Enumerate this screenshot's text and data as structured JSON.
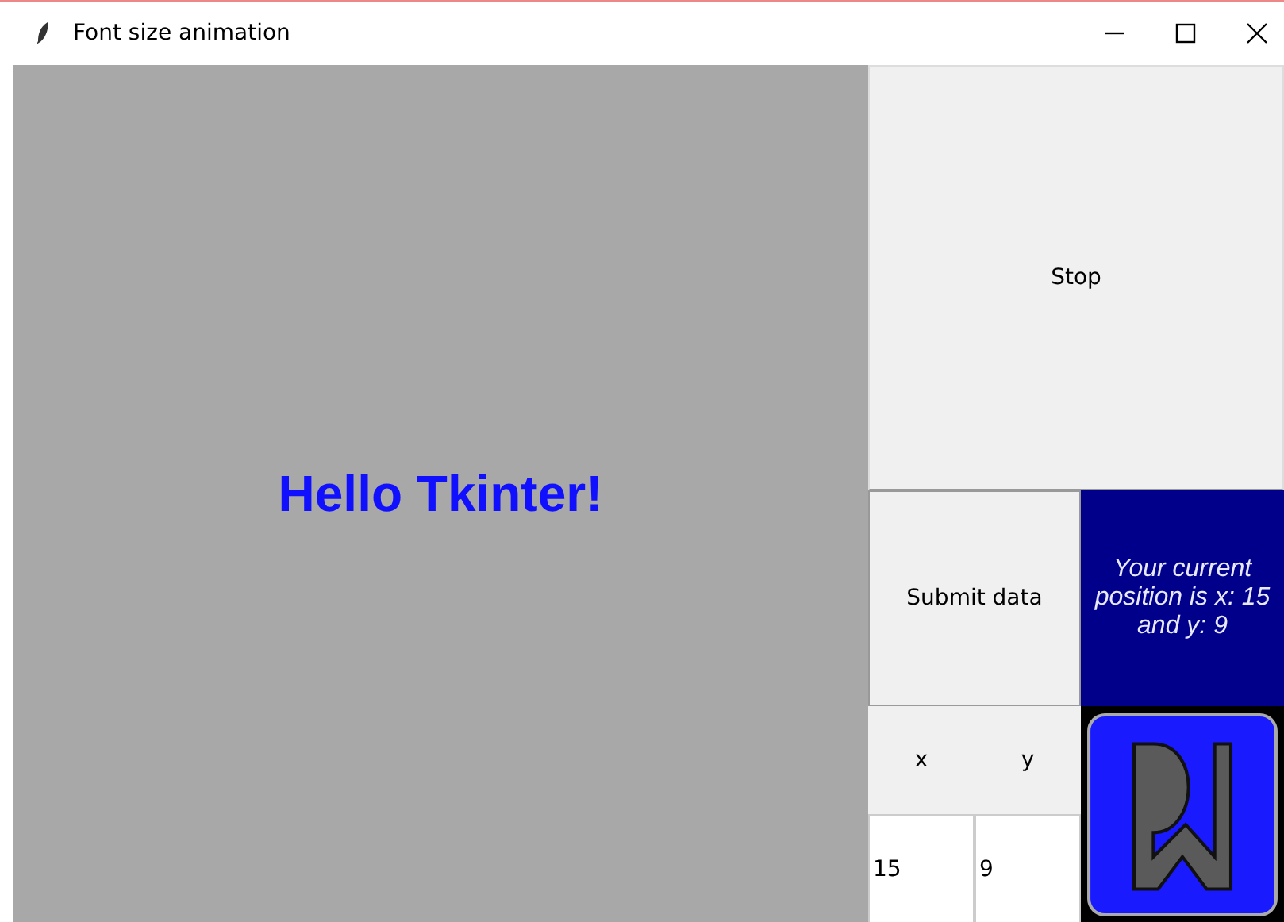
{
  "window": {
    "title": "Font size animation"
  },
  "canvas": {
    "text": "Hello Tkinter!"
  },
  "stop_button": {
    "label": "Stop"
  },
  "submit_button": {
    "label": "Submit data"
  },
  "position_label": {
    "text": "Your current position is x: 15 and y: 9"
  },
  "x_label": "x",
  "y_label": "y",
  "x_field": {
    "value": "15"
  },
  "y_field": {
    "value": "9"
  }
}
